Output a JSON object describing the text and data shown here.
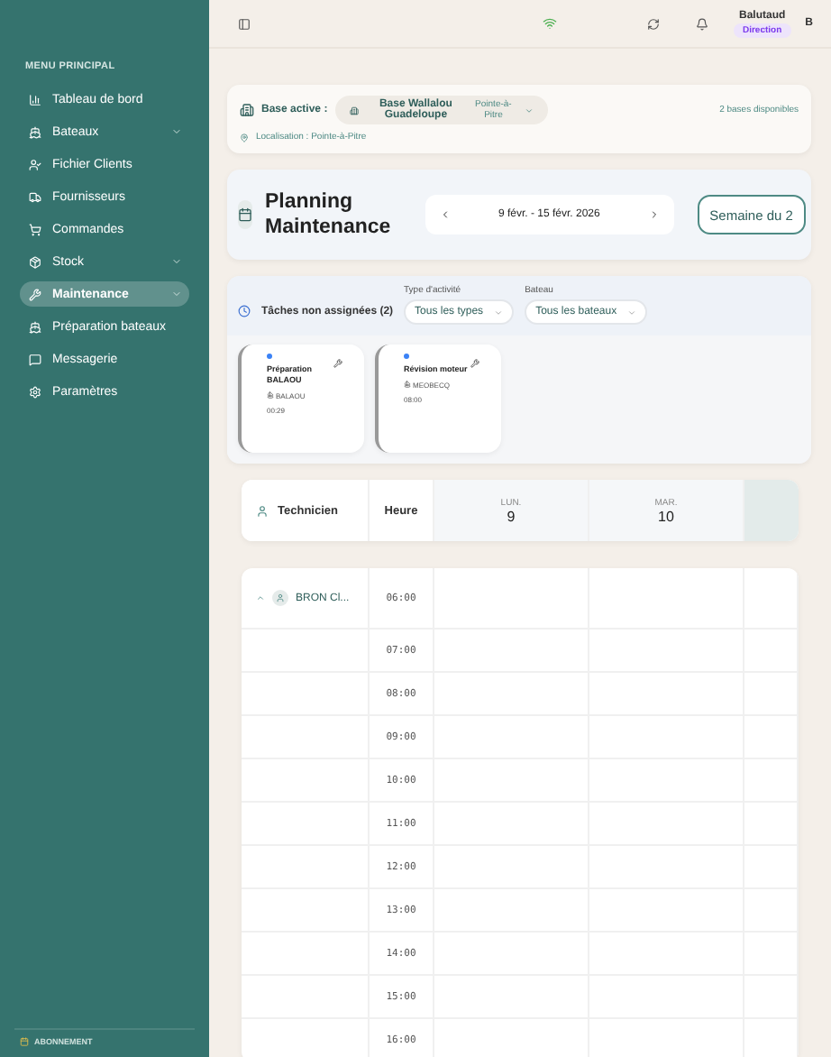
{
  "sidebar": {
    "heading": "MENU PRINCIPAL",
    "items": [
      {
        "label": "Tableau de bord",
        "expandable": false,
        "selected": false
      },
      {
        "label": "Bateaux",
        "expandable": true,
        "selected": false
      },
      {
        "label": "Fichier Clients",
        "expandable": false,
        "selected": false
      },
      {
        "label": "Fournisseurs",
        "expandable": false,
        "selected": false
      },
      {
        "label": "Commandes",
        "expandable": false,
        "selected": false
      },
      {
        "label": "Stock",
        "expandable": true,
        "selected": false
      },
      {
        "label": "Maintenance",
        "expandable": true,
        "selected": true
      },
      {
        "label": "Préparation bateaux",
        "expandable": false,
        "selected": false
      },
      {
        "label": "Messagerie",
        "expandable": false,
        "selected": false
      },
      {
        "label": "Paramètres",
        "expandable": false,
        "selected": false
      }
    ],
    "footer": "ABONNEMENT"
  },
  "topbar": {
    "user_name": "Balutaud",
    "role": "Direction",
    "avatar": "B"
  },
  "base": {
    "label": "Base active :",
    "name": "Base Wallalou Guadeloupe",
    "city": "Pointe-à-Pitre",
    "available": "2 bases disponibles",
    "location": "Localisation : Pointe-à-Pitre"
  },
  "planning": {
    "title": "Planning Maintenance",
    "range": "9 févr. - 15 févr. 2026",
    "week_button": "Semaine du 2"
  },
  "unassigned": {
    "title": "Tâches non assignées (2)",
    "filters": [
      {
        "label": "Type d'activité",
        "value": "Tous les types"
      },
      {
        "label": "Bateau",
        "value": "Tous les bateaux"
      }
    ],
    "tasks": [
      {
        "title": "Préparation BALAOU",
        "boat": "BALAOU",
        "time": "00:29",
        "color": "#3b82f6"
      },
      {
        "title": "Révision moteur",
        "boat": "MEOBECQ",
        "time": "08:00",
        "color": "#3b82f6"
      }
    ]
  },
  "schedule": {
    "technician_header": "Technicien",
    "hour_header": "Heure",
    "days": [
      {
        "weekday": "LUN.",
        "day": "9"
      },
      {
        "weekday": "MAR.",
        "day": "10"
      }
    ],
    "technician": "BRON Cl...",
    "expanded": true,
    "hours": [
      "06:00",
      "07:00",
      "08:00",
      "09:00",
      "10:00",
      "11:00",
      "12:00",
      "13:00",
      "14:00",
      "15:00",
      "16:00"
    ]
  }
}
